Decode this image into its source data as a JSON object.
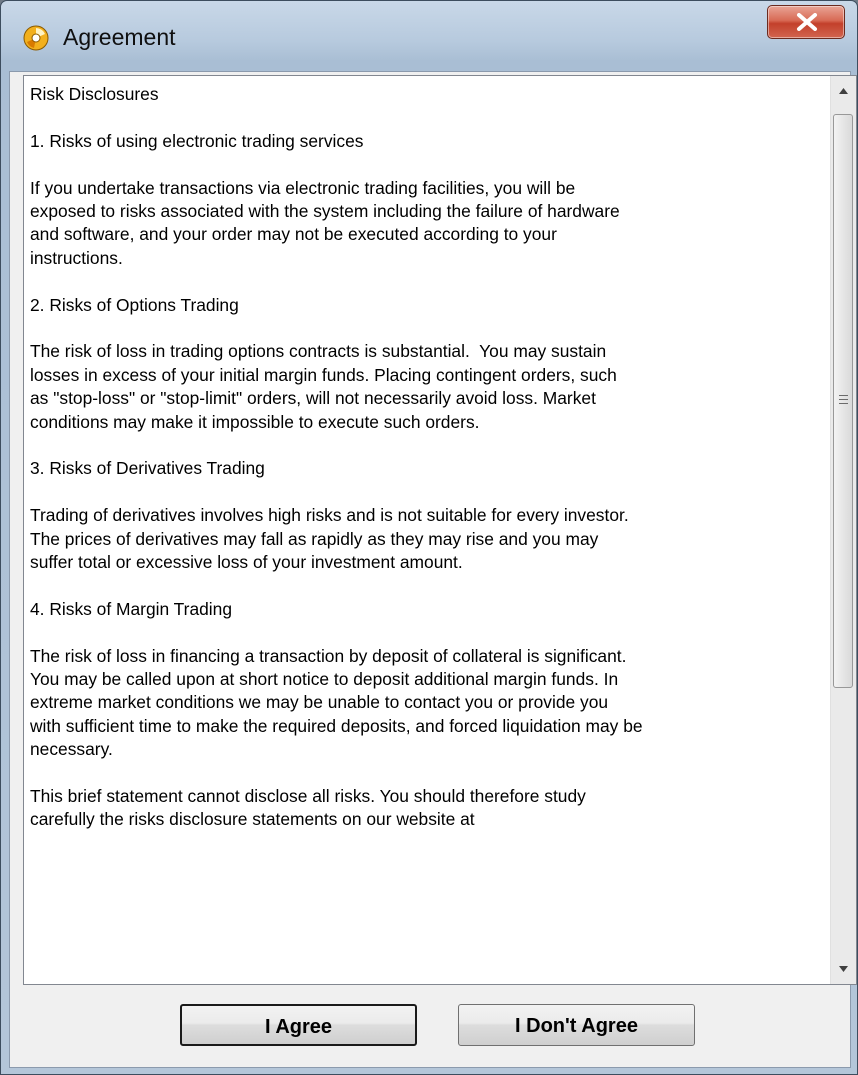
{
  "window": {
    "title": "Agreement",
    "icon": "app-logo-icon",
    "close_icon": "close-icon"
  },
  "agreement": {
    "paragraphs": [
      "Risk Disclosures",
      "1. Risks of using electronic trading services",
      "If you undertake transactions via electronic trading facilities, you will be\nexposed to risks associated with the system including the failure of hardware\nand software, and your order may not be executed according to your\ninstructions.",
      "2. Risks of Options Trading",
      "The risk of loss in trading options contracts is substantial.  You may sustain\nlosses in excess of your initial margin funds. Placing contingent orders, such\nas \"stop-loss\" or \"stop-limit\" orders, will not necessarily avoid loss. Market\nconditions may make it impossible to execute such orders.",
      "3. Risks of Derivatives Trading",
      "Trading of derivatives involves high risks and is not suitable for every investor.\nThe prices of derivatives may fall as rapidly as they may rise and you may\nsuffer total or excessive loss of your investment amount.",
      "4. Risks of Margin Trading",
      "The risk of loss in financing a transaction by deposit of collateral is significant.\nYou may be called upon at short notice to deposit additional margin funds. In\nextreme market conditions we may be unable to contact you or provide you\nwith sufficient time to make the required deposits, and forced liquidation may be\nnecessary.",
      "This brief statement cannot disclose all risks. You should therefore study\ncarefully the risks disclosure statements on our website at"
    ]
  },
  "buttons": {
    "agree_label": "I Agree",
    "disagree_label": "I Don't Agree"
  },
  "colors": {
    "close_button": "#c3402b",
    "text_background": "#ffffff",
    "dialog_background": "#f0f0f0"
  }
}
